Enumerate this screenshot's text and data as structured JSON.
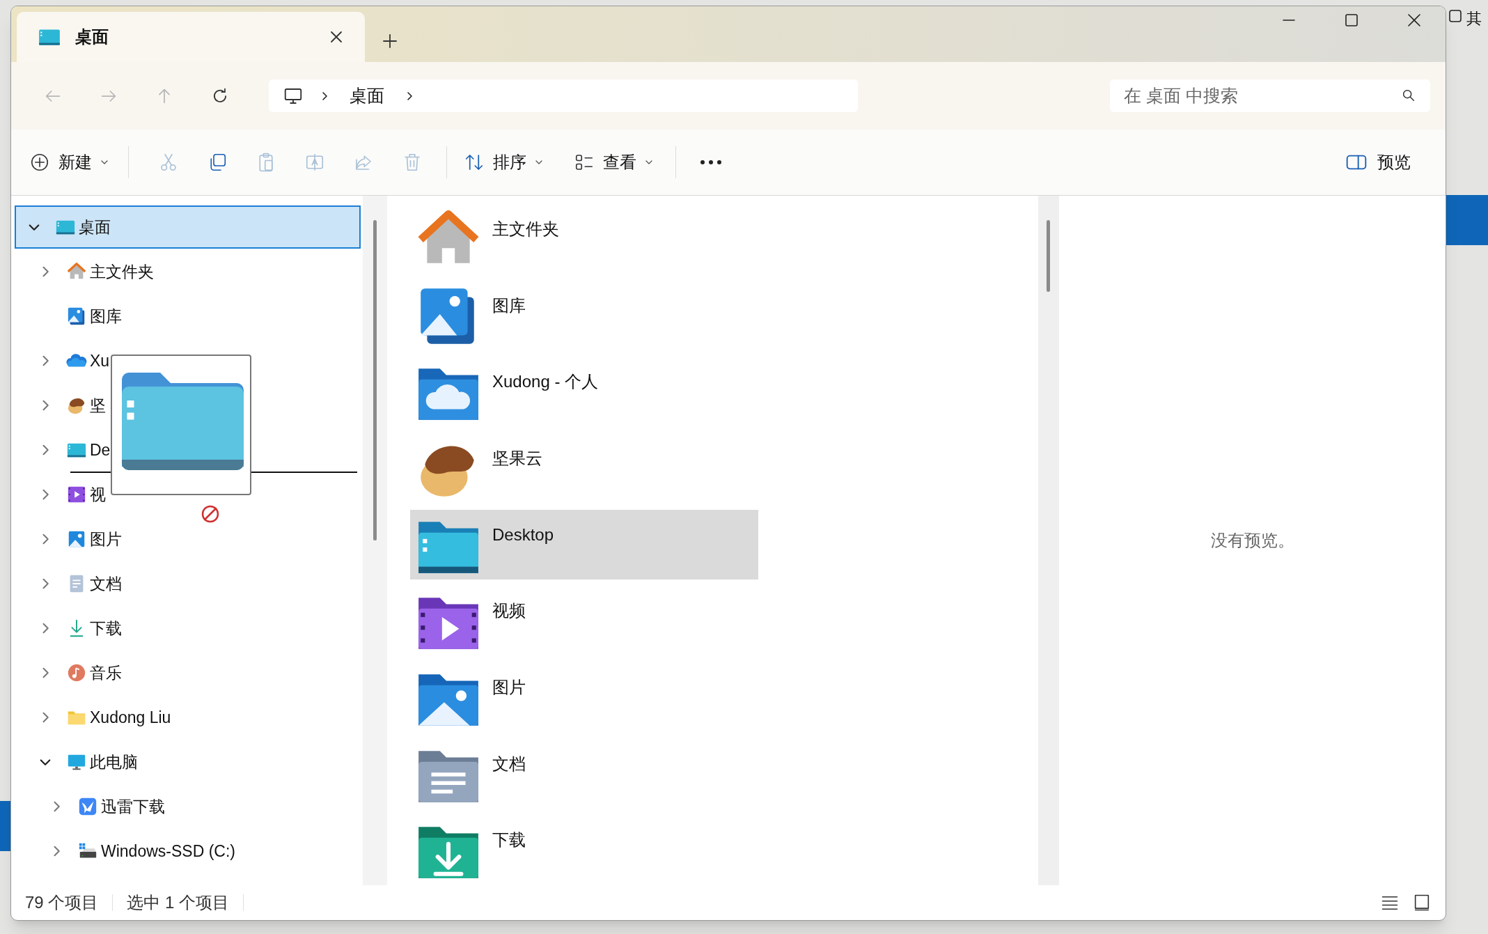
{
  "desktop": {
    "corner_label": "其"
  },
  "window": {
    "tab": {
      "title": "桌面"
    }
  },
  "address_bar": {
    "breadcrumb": [
      "桌面"
    ],
    "search": {
      "placeholder": "在 桌面 中搜索"
    }
  },
  "nav": [
    {
      "kind": "back",
      "disabled": true
    },
    {
      "kind": "forward",
      "disabled": true
    },
    {
      "kind": "up",
      "disabled": true
    },
    {
      "kind": "refresh",
      "disabled": false
    }
  ],
  "toolbar": {
    "new": {
      "label": "新建"
    },
    "actions": [
      {
        "kind": "cut",
        "disabled": true
      },
      {
        "kind": "copy",
        "disabled": false
      },
      {
        "kind": "paste",
        "disabled": true
      },
      {
        "kind": "rename",
        "disabled": true
      },
      {
        "kind": "share",
        "disabled": true
      },
      {
        "kind": "delete",
        "disabled": true
      }
    ],
    "sort": {
      "label": "排序"
    },
    "view": {
      "label": "查看"
    },
    "preview": {
      "label": "预览"
    }
  },
  "sidebar": {
    "items": [
      {
        "label": "桌面",
        "kind": "desktop",
        "selected": true,
        "expanded": true,
        "children": [
          {
            "label": "主文件夹",
            "kind": "home",
            "selected": false,
            "expanded": false
          },
          {
            "label": "图库",
            "kind": "gallery",
            "selected": false
          },
          {
            "label": "Xu",
            "kind": "cloud",
            "selected": false,
            "expanded": false
          },
          {
            "label": "坚",
            "kind": "nut",
            "selected": false,
            "expanded": false
          },
          {
            "label": "De",
            "kind": "desktop",
            "selected": false,
            "expanded": false
          },
          {
            "label": "视",
            "kind": "video",
            "selected": false,
            "expanded": false
          },
          {
            "label": "图片",
            "kind": "pictures",
            "selected": false,
            "expanded": false
          },
          {
            "label": "文档",
            "kind": "documents",
            "selected": false,
            "expanded": false
          },
          {
            "label": "下载",
            "kind": "downloads",
            "selected": false,
            "expanded": false
          },
          {
            "label": "音乐",
            "kind": "music",
            "selected": false,
            "expanded": false
          },
          {
            "label": "Xudong Liu",
            "kind": "folder",
            "selected": false,
            "expanded": false
          },
          {
            "label": "此电脑",
            "kind": "pc",
            "selected": false,
            "expanded": true,
            "children": [
              {
                "label": "迅雷下载",
                "kind": "thunder",
                "selected": false,
                "expanded": false
              },
              {
                "label": "Windows-SSD (C:)",
                "kind": "drive",
                "selected": false,
                "expanded": false
              }
            ]
          }
        ]
      }
    ]
  },
  "files": [
    {
      "label": "主文件夹",
      "kind": "home",
      "selected": false
    },
    {
      "label": "图库",
      "kind": "gallery",
      "selected": false
    },
    {
      "label": "Xudong - 个人",
      "kind": "cloud",
      "selected": false
    },
    {
      "label": "坚果云",
      "kind": "nut",
      "selected": false
    },
    {
      "label": "Desktop",
      "kind": "desktop",
      "selected": true
    },
    {
      "label": "视频",
      "kind": "video",
      "selected": false
    },
    {
      "label": "图片",
      "kind": "pictures",
      "selected": false
    },
    {
      "label": "文档",
      "kind": "documents",
      "selected": false
    },
    {
      "label": "下载",
      "kind": "downloads",
      "selected": false
    }
  ],
  "preview_pane": {
    "message": "没有预览。"
  },
  "status_bar": {
    "item_count": "79 个项目",
    "selection": "选中 1 个项目"
  }
}
